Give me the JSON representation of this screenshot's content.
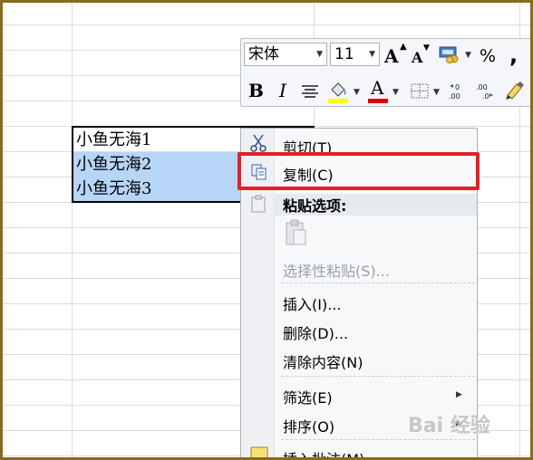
{
  "toolbar": {
    "font_name": "宋体",
    "font_size": "11",
    "grow_font": "A",
    "shrink_font": "A",
    "percent": "%",
    "comma": ",",
    "bold": "B",
    "italic": "I",
    "font_color_letter": "A",
    "highlight_color": "#ffff00",
    "font_color": "#e00000"
  },
  "cells": [
    {
      "text": "小鱼无海1",
      "selected": false
    },
    {
      "text": "小鱼无海2",
      "selected": true
    },
    {
      "text": "小鱼无海3",
      "selected": true
    }
  ],
  "menu": {
    "cut": "剪切(T)",
    "copy": "复制(C)",
    "paste_options": "粘贴选项:",
    "paste_special": "选择性粘贴(S)...",
    "insert": "插入(I)...",
    "delete": "删除(D)...",
    "clear": "清除内容(N)",
    "filter": "筛选(E)",
    "sort": "排序(O)",
    "insert_comment": "插入批注(M)"
  },
  "watermark": "Bai 经验",
  "colors": {
    "highlight": "#e3202a",
    "selection": "#b7d6f7"
  }
}
